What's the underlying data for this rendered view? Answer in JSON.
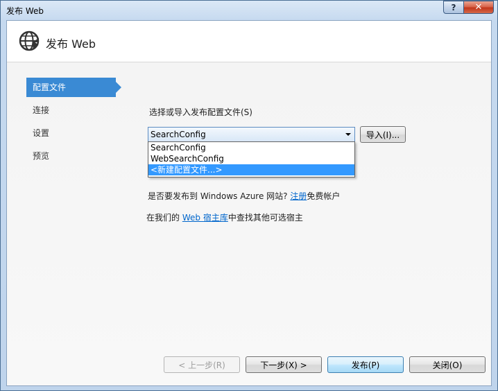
{
  "window": {
    "title": "发布 Web",
    "help_label": "?",
    "close_label": "✕"
  },
  "header": {
    "title": "发布 Web",
    "icon": "globe-publish-icon"
  },
  "nav": {
    "items": [
      {
        "label": "配置文件",
        "active": true
      },
      {
        "label": "连接",
        "active": false
      },
      {
        "label": "设置",
        "active": false
      },
      {
        "label": "预览",
        "active": false
      }
    ]
  },
  "profile": {
    "label": "选择或导入发布配置文件(S)",
    "selected": "SearchConfig",
    "options": [
      "SearchConfig",
      "WebSearchConfig",
      "<新建配置文件...>"
    ],
    "highlighted_option": "<新建配置文件...>",
    "import_label": "导入(I)..."
  },
  "azure": {
    "text_before": "是否要发布到 Windows Azure 网站?",
    "link": "注册",
    "text_after": "免费帐户"
  },
  "hosting": {
    "text_before": "在我们的",
    "link": "Web 宿主库",
    "text_after": "中查找其他可选宿主"
  },
  "footer": {
    "prev_label": "< 上一步(R)",
    "next_label": "下一步(X) >",
    "publish_label": "发布(P)",
    "close_label": "关闭(O)"
  },
  "colors": {
    "accent": "#3a8ad4",
    "selection": "#3399ff",
    "link": "#0066cc"
  }
}
